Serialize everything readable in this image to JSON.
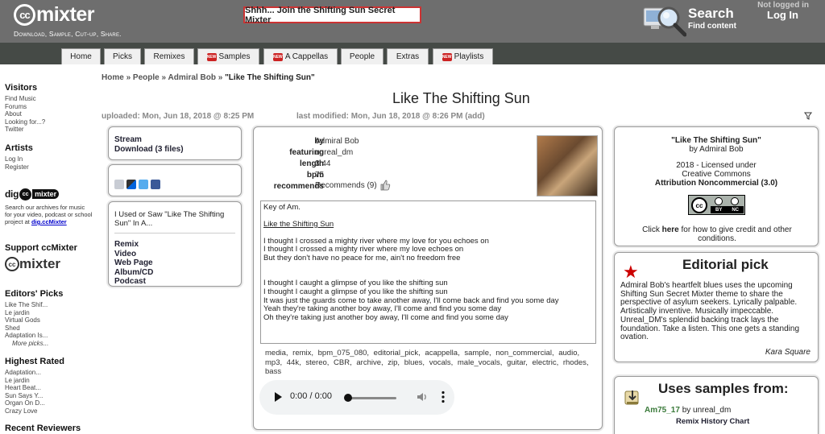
{
  "header": {
    "logo_cc": "cc",
    "logo_word": "mixter",
    "tagline": "Download, Sample, Cut-up, Share.",
    "promo_button": "Shhh... Join the Shifting Sun Secret Mixter",
    "search_title": "Search",
    "search_sub": "Find content",
    "login_state": "Not logged in",
    "login_link": "Log In"
  },
  "tabs": [
    {
      "label": "Home",
      "new": false
    },
    {
      "label": "Picks",
      "new": false
    },
    {
      "label": "Remixes",
      "new": false
    },
    {
      "label": "Samples",
      "new": true
    },
    {
      "label": "A Cappellas",
      "new": true
    },
    {
      "label": "People",
      "new": false
    },
    {
      "label": "Extras",
      "new": false
    },
    {
      "label": "Playlists",
      "new": true
    }
  ],
  "new_badge": "NEW",
  "sidebar": {
    "visitors_head": "Visitors",
    "visitors": [
      "Find Music",
      "Forums",
      "About",
      "Looking for...?",
      "Twitter"
    ],
    "artists_head": "Artists",
    "artists": [
      "Log In",
      "Register"
    ],
    "dig_word_left": "dig",
    "dig_cc": "cc",
    "dig_word_right": "mixter",
    "dig_desc": "Search our archives for music for your video, podcast or school project at",
    "dig_link": "dig.ccMixter",
    "support_head": "Support ccMixter",
    "support_logo_cc": "cc",
    "support_logo_word": "mixter",
    "picks_head": "Editors' Picks",
    "picks": [
      "Like The Shif...",
      "Le jardin",
      "Virtual Gods",
      "Shed",
      "Adaptation Is..."
    ],
    "picks_more": "More picks...",
    "rated_head": "Highest Rated",
    "rated": [
      "Adaptation...",
      "Le jardin",
      "Heart Beat...",
      "Sun Says Y...",
      "Organ On D...",
      "Crazy Love"
    ],
    "reviewers_head": "Recent Reviewers"
  },
  "breadcrumb": {
    "home": "Home",
    "sep": "»",
    "people": "People",
    "artist": "Admiral Bob",
    "current": "\"Like The Shifting Sun\""
  },
  "page_title": "Like The Shifting Sun",
  "uploaded": "uploaded: Mon, Jun 18, 2018 @ 8:25 PM",
  "modified": "last modified: Mon, Jun 18, 2018 @ 8:26 PM",
  "modified_add": "(add)",
  "stream_box": {
    "stream": "Stream",
    "download": "Download (3 files)"
  },
  "used_box": {
    "title": "I Used or Saw \"Like The Shifting Sun\" In A...",
    "items": [
      "Remix",
      "Video",
      "Web Page",
      "Album/CD",
      "Podcast"
    ]
  },
  "details": {
    "by_label": "by",
    "by_value": "Admiral Bob",
    "featuring_label": "featuring",
    "featuring_value": "unreal_dm",
    "length_label": "length",
    "length_value": "3:44",
    "bpm_label": "bpm",
    "bpm_value": "75",
    "recommends_label": "recommends",
    "recommends_value": "Recommends (9)"
  },
  "description": {
    "key_line": "Key of Am.",
    "song_link": "Like the Shifting Sun",
    "verse1": [
      "I thought I crossed a mighty river where my love for you echoes on",
      "I thought I crossed a mighty river where my love echoes on",
      "But they don't have no peace for me, ain't no freedom free"
    ],
    "verse2": [
      "I thought I caught a glimpse of you like the shifting sun",
      "I thought I caught a glimpse of you like the shifting sun",
      "It was just the guards come to take another away, I'll come back and find you some day",
      "Yeah they're taking another boy away, I'll come and find you some day",
      "Oh they're taking just another boy away, I'll come and find you some day"
    ]
  },
  "tags": "media, remix, bpm_075_080, editorial_pick, acappella, sample, non_commercial, audio, mp3, 44k, stereo, CBR, archive, zip, blues, vocals, male_vocals, guitar, electric, rhodes, bass",
  "player": {
    "time": "0:00 / 0:00"
  },
  "license": {
    "title": "\"Like The Shifting Sun\"",
    "by": "by Admiral Bob",
    "line1": "2018 - Licensed under",
    "line2": "Creative Commons",
    "line3": "Attribution Noncommercial (3.0)",
    "badge_cc": "cc",
    "badge_by": "BY",
    "badge_nc": "NC",
    "credit_prefix": "Click",
    "credit_here": "here",
    "credit_suffix": "for how to give credit and other conditions."
  },
  "editorial": {
    "title": "Editorial pick",
    "text": "Admiral Bob's heartfelt blues uses the upcoming Shifting Sun Secret Mixter theme to share the perspective of asylum seekers. Lyrically palpable. Artistically inventive. Musically impeccable. Unreal_DM's splendid backing track lays the foundation. Take a listen. This one gets a standing ovation.",
    "author": "Kara Square"
  },
  "samples": {
    "title": "Uses samples from:",
    "name": "Am75_17",
    "by": "by",
    "artist": "unreal_dm",
    "chart": "Remix History Chart"
  },
  "colors": {
    "header_bg": "#6e6e6e",
    "tabbar_bg": "#454a46",
    "promo_border": "#cc3333",
    "new_badge": "#cc2222",
    "star": "#cc0000"
  }
}
